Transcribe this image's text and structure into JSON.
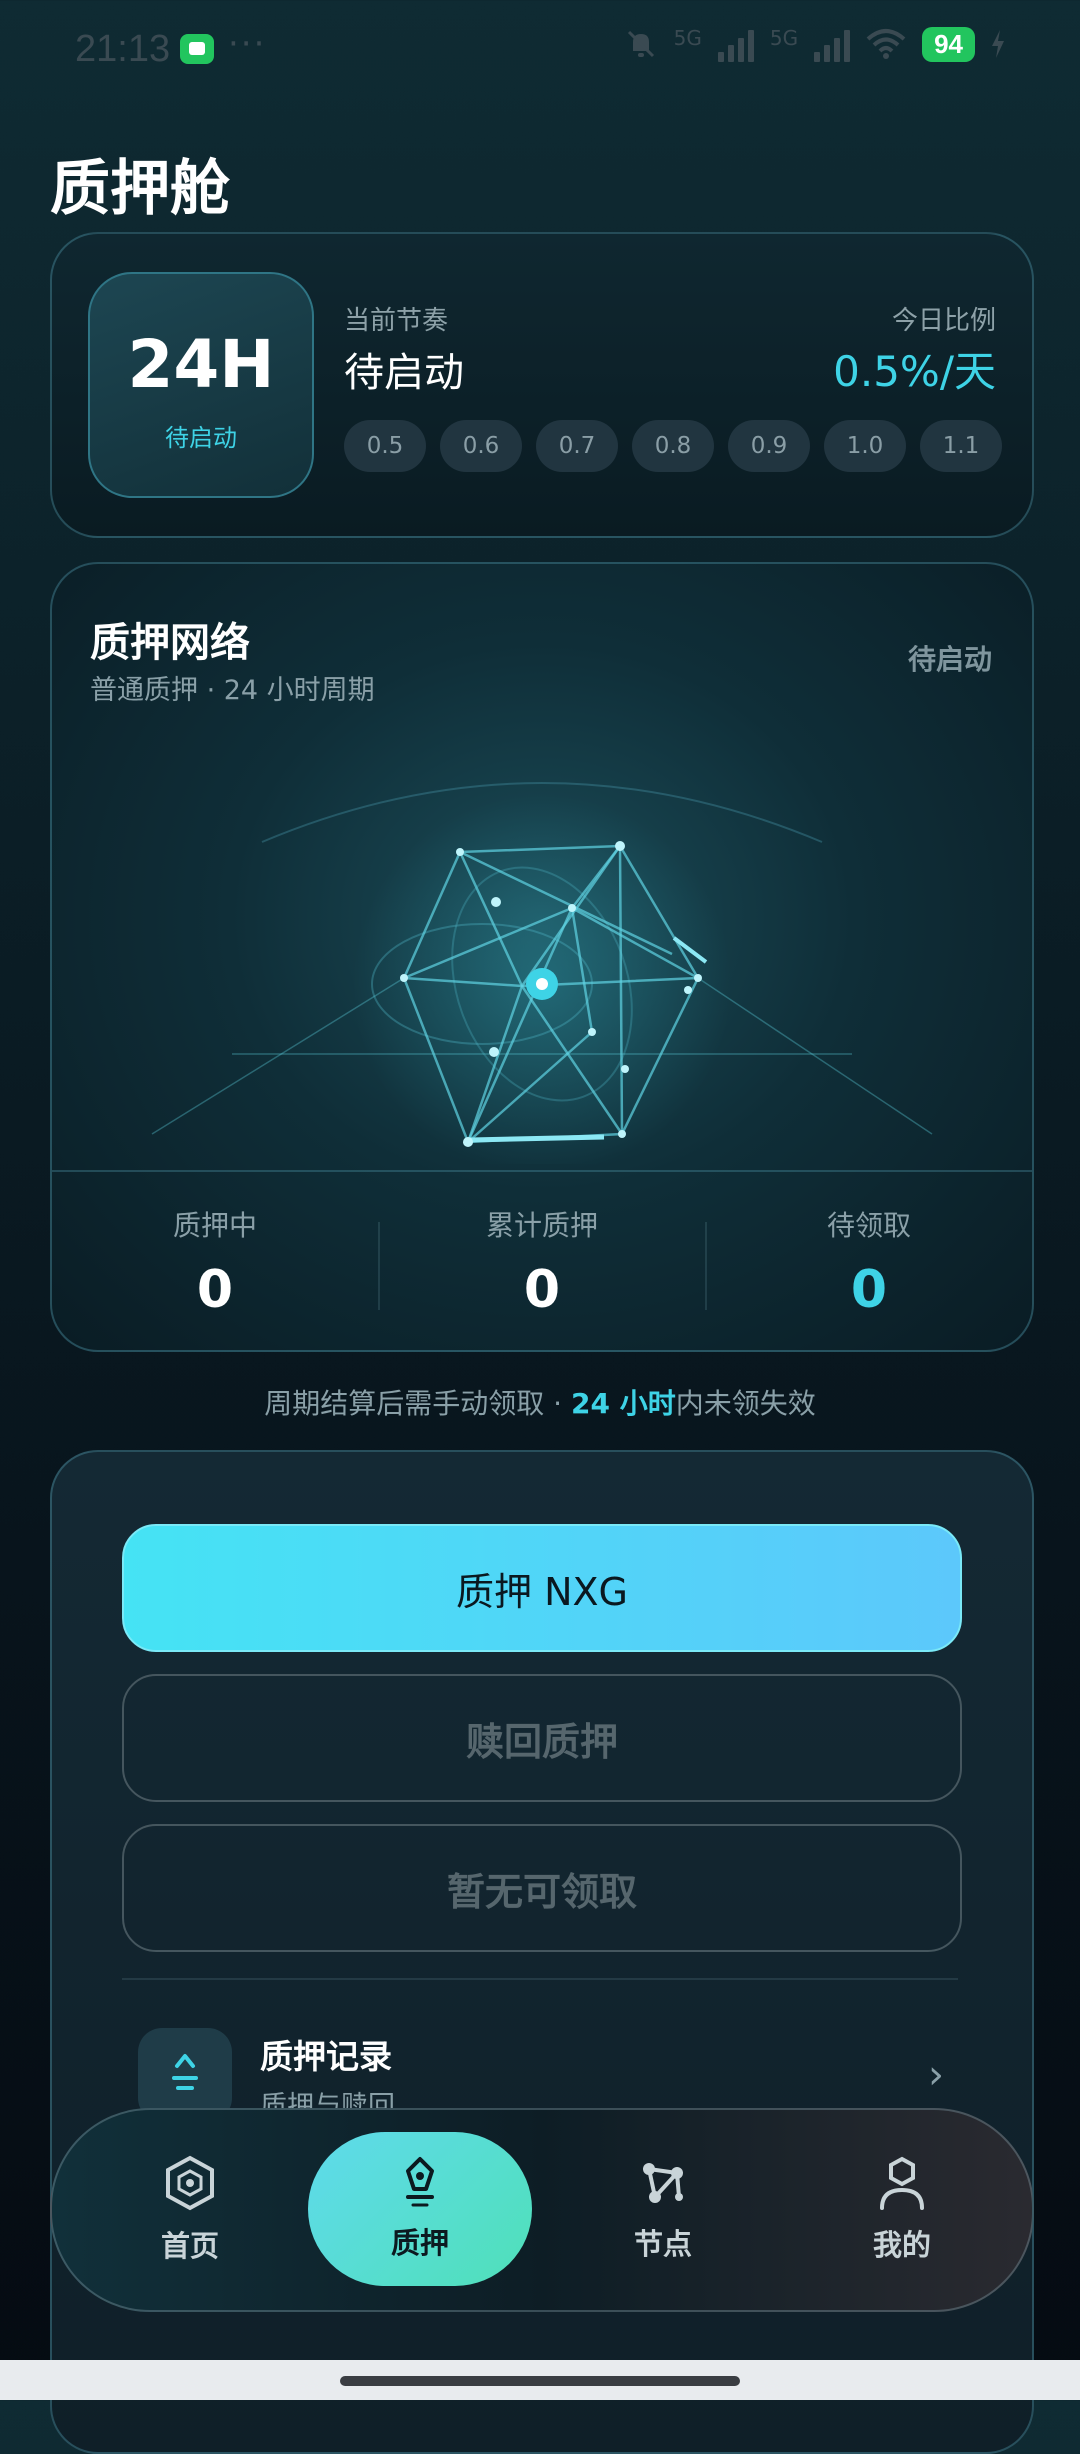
{
  "status_bar": {
    "time": "21:13",
    "dots": "···",
    "network1": "5G",
    "network2": "5G",
    "battery": "94",
    "accent": "#22c55e"
  },
  "page": {
    "title": "质押舱"
  },
  "rhythm": {
    "box_main": "24H",
    "box_sub": "待启动",
    "current_label": "当前节奏",
    "current_value": "待启动",
    "ratio_label": "今日比例",
    "ratio_value": "0.5%/天",
    "options": [
      "0.5",
      "0.6",
      "0.7",
      "0.8",
      "0.9",
      "1.0",
      "1.1"
    ]
  },
  "network": {
    "title": "质押网络",
    "subtitle": "普通质押 · 24 小时周期",
    "status": "待启动",
    "stats": [
      {
        "label": "质押中",
        "value": "0"
      },
      {
        "label": "累计质押",
        "value": "0"
      },
      {
        "label": "待领取",
        "value": "0"
      }
    ]
  },
  "note": {
    "prefix": "周期结算后需手动领取 · ",
    "highlight": "24 小时",
    "suffix": "内未领失效"
  },
  "actions": {
    "stake": "质押 NXG",
    "redeem": "赎回质押",
    "claim": "暂无可领取"
  },
  "record": {
    "title": "质押记录",
    "subtitle": "质押与赎回",
    "icon": "stake-record-icon"
  },
  "nav": {
    "items": [
      {
        "label": "首页",
        "icon": "home-hexagon-icon"
      },
      {
        "label": "质押",
        "icon": "pen-stake-icon"
      },
      {
        "label": "节点",
        "icon": "node-network-icon"
      },
      {
        "label": "我的",
        "icon": "user-icon"
      }
    ],
    "active_index": 1
  },
  "colors": {
    "accent_cyan": "#3ed3e6",
    "primary_button": "#45e3f4"
  }
}
